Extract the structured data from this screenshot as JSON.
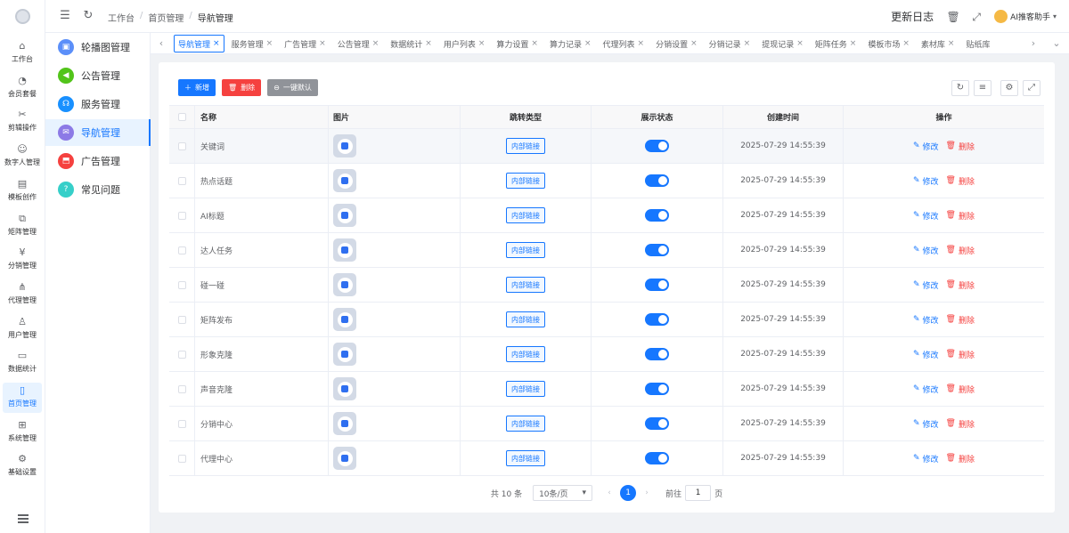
{
  "sidebar": {
    "items": [
      {
        "label": "工作台",
        "icon": "home-icon"
      },
      {
        "label": "会员套餐",
        "icon": "medal-icon"
      },
      {
        "label": "剪辑操作",
        "icon": "scissors-icon"
      },
      {
        "label": "数字人管理",
        "icon": "person-icon"
      },
      {
        "label": "模板创作",
        "icon": "template-icon"
      },
      {
        "label": "矩阵管理",
        "icon": "matrix-icon"
      },
      {
        "label": "分销管理",
        "icon": "yen-icon"
      },
      {
        "label": "代理管理",
        "icon": "org-icon"
      },
      {
        "label": "用户管理",
        "icon": "user-icon"
      },
      {
        "label": "数据统计",
        "icon": "chart-icon"
      },
      {
        "label": "首页管理",
        "icon": "tablet-icon"
      },
      {
        "label": "系统管理",
        "icon": "grid-icon"
      },
      {
        "label": "基础设置",
        "icon": "gear-icon"
      }
    ],
    "active_index": 10
  },
  "submenu": {
    "items": [
      {
        "label": "轮播图管理",
        "color": "#5b8ff9"
      },
      {
        "label": "公告管理",
        "color": "#52c41a"
      },
      {
        "label": "服务管理",
        "color": "#1890ff"
      },
      {
        "label": "导航管理",
        "color": "#8c7ae6"
      },
      {
        "label": "广告管理",
        "color": "#f5413f"
      },
      {
        "label": "常见问题",
        "color": "#36cfc9"
      }
    ],
    "active_index": 3
  },
  "header": {
    "breadcrumb": [
      "工作台",
      "首页管理",
      "导航管理"
    ],
    "log_label": "更新日志",
    "user_name": "AI推客助手"
  },
  "tabs": [
    {
      "label": "导航管理",
      "active": true
    },
    {
      "label": "服务管理"
    },
    {
      "label": "广告管理"
    },
    {
      "label": "公告管理"
    },
    {
      "label": "数据统计"
    },
    {
      "label": "用户列表"
    },
    {
      "label": "算力设置"
    },
    {
      "label": "算力记录"
    },
    {
      "label": "代理列表"
    },
    {
      "label": "分销设置"
    },
    {
      "label": "分销记录"
    },
    {
      "label": "提现记录"
    },
    {
      "label": "矩阵任务"
    },
    {
      "label": "模板市场"
    },
    {
      "label": "素材库"
    },
    {
      "label": "贴纸库"
    }
  ],
  "toolbar": {
    "add_label": "新增",
    "delete_label": "删除",
    "default_label": "一键默认"
  },
  "table": {
    "columns": [
      "名称",
      "图片",
      "跳转类型",
      "展示状态",
      "创建时间",
      "操作"
    ],
    "rows": [
      {
        "name": "关键词",
        "type": "内部链接",
        "time": "2025-07-29 14:55:39"
      },
      {
        "name": "热点话题",
        "type": "内部链接",
        "time": "2025-07-29 14:55:39"
      },
      {
        "name": "AI标题",
        "type": "内部链接",
        "time": "2025-07-29 14:55:39"
      },
      {
        "name": "达人任务",
        "type": "内部链接",
        "time": "2025-07-29 14:55:39"
      },
      {
        "name": "碰一碰",
        "type": "内部链接",
        "time": "2025-07-29 14:55:39"
      },
      {
        "name": "矩阵发布",
        "type": "内部链接",
        "time": "2025-07-29 14:55:39"
      },
      {
        "name": "形象克隆",
        "type": "内部链接",
        "time": "2025-07-29 14:55:39"
      },
      {
        "name": "声音克隆",
        "type": "内部链接",
        "time": "2025-07-29 14:55:39"
      },
      {
        "name": "分销中心",
        "type": "内部链接",
        "time": "2025-07-29 14:55:39"
      },
      {
        "name": "代理中心",
        "type": "内部链接",
        "time": "2025-07-29 14:55:39"
      }
    ],
    "edit_label": "修改",
    "delete_label": "删除"
  },
  "pagination": {
    "total": "共 10 条",
    "page_size": "10条/页",
    "current": "1",
    "goto_prefix": "前往",
    "goto_value": "1",
    "goto_suffix": "页"
  },
  "colors": {
    "primary": "#1677ff",
    "danger": "#f5413f",
    "info": "#909399"
  }
}
